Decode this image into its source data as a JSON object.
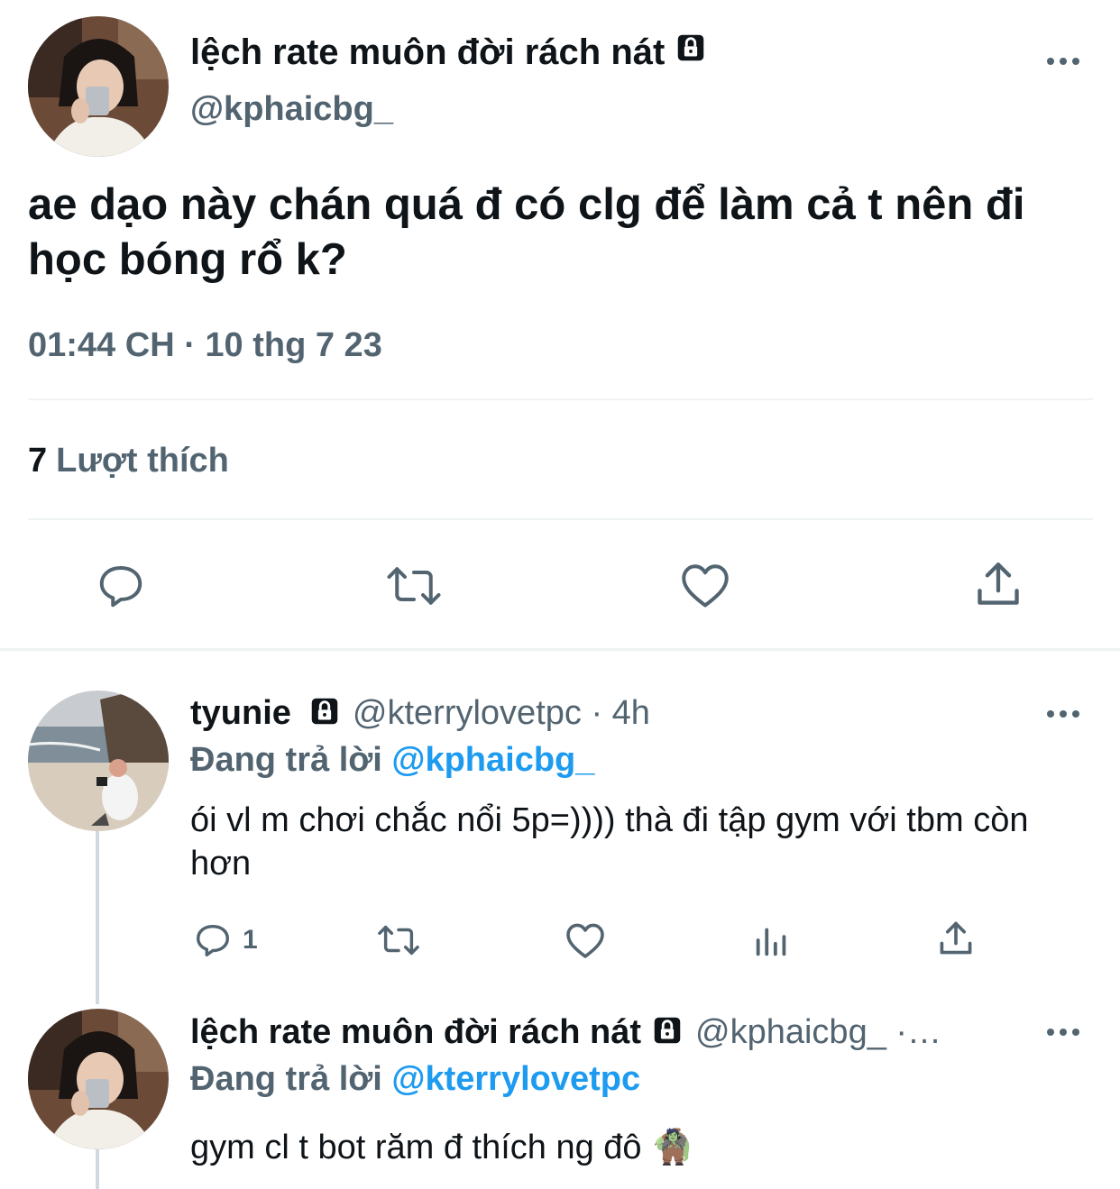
{
  "main_tweet": {
    "display_name": "lệch rate muôn đời rách nát",
    "handle": "@kphaicbg_",
    "text": "ae dạo này chán quá đ có clg để làm cả t nên đi học bóng rổ k?",
    "timestamp": "01:44 CH · 10 thg 7 23",
    "likes_count": "7",
    "likes_label": "Lượt thích",
    "icons": [
      "lock-icon",
      "more-icon",
      "reply-icon",
      "retweet-icon",
      "like-icon",
      "share-icon"
    ]
  },
  "replies": [
    {
      "display_name": "tyunie",
      "handle_time": "@kterrylovetpc · 4h",
      "replying_prefix": "Đang trả lời",
      "replying_to": "@kphaicbg_",
      "text": "ói vl m chơi chắc nổi 5p=)))) thà đi tập gym với tbm còn hơn",
      "reply_count": "1",
      "icons": [
        "lock-icon",
        "more-icon",
        "reply-icon",
        "retweet-icon",
        "like-icon",
        "views-icon",
        "share-icon"
      ]
    },
    {
      "display_name": "lệch rate muôn đời rách nát",
      "handle_time": "@kphaicbg_ ·…",
      "replying_prefix": "Đang trả lời",
      "replying_to": "@kterrylovetpc",
      "text": "gym cl t bot răm đ thích ng đô 🧌",
      "icons": [
        "lock-icon",
        "more-icon"
      ]
    }
  ],
  "colors": {
    "text_primary": "#0f1419",
    "text_secondary": "#536471",
    "link": "#1d9bf0",
    "divider": "#eff3f4"
  }
}
